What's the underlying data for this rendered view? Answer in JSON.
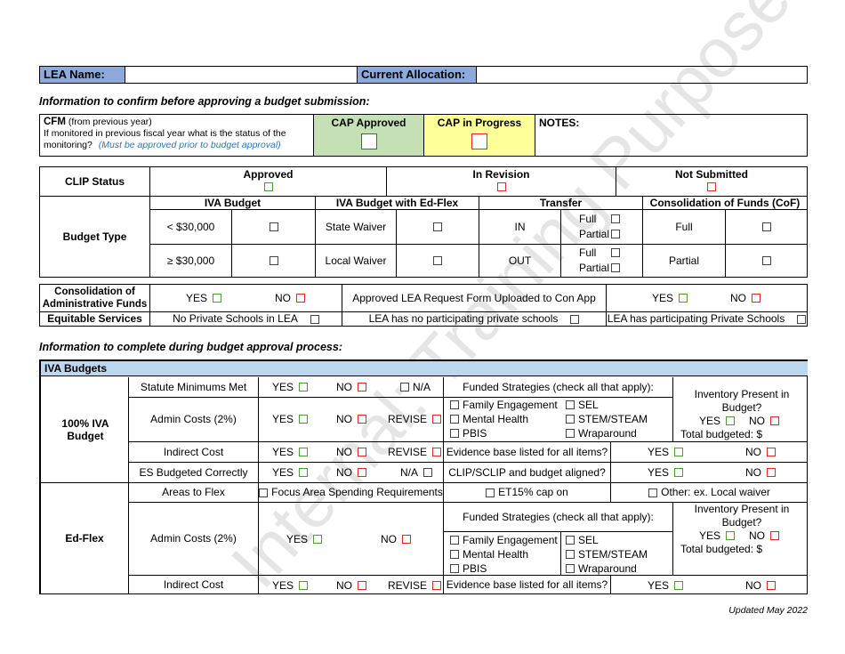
{
  "header": {
    "lea_name_label": "LEA Name:",
    "lea_name_value": "",
    "current_allocation_label": "Current Allocation:",
    "current_allocation_value": ""
  },
  "section1_heading": "Information to confirm before approving a budget submission:",
  "cfm": {
    "title": "CFM",
    "title_suffix": "(from previous year)",
    "question": "If monitored in previous fiscal year what is the status of the monitoring?",
    "note": "(Must be approved prior to budget approval)",
    "cap_approved": "CAP Approved",
    "cap_in_progress": "CAP in Progress",
    "notes_label": "NOTES:"
  },
  "clip": {
    "label": "CLIP Status",
    "options": [
      "Approved",
      "In Revision",
      "Not Submitted"
    ]
  },
  "budget_type": {
    "label": "Budget Type",
    "groups": [
      "IVA Budget",
      "IVA Budget with Ed-Flex",
      "Transfer",
      "Consolidation of Funds (CoF)"
    ],
    "iva_rows": [
      "< $30,000",
      "≥ $30,000"
    ],
    "edflex_rows": [
      "State Waiver",
      "Local Waiver"
    ],
    "transfer_rows": [
      "IN",
      "OUT"
    ],
    "transfer_opts": [
      "Full",
      "Partial"
    ],
    "cof_rows": [
      "Full",
      "Partial"
    ]
  },
  "consolidation": {
    "label": "Consolidation of Administrative Funds",
    "yes": "YES",
    "no": "NO",
    "form_label": "Approved LEA Request Form Uploaded to Con App"
  },
  "equitable": {
    "label": "Equitable Services",
    "options": [
      "No Private Schools in LEA",
      "LEA has no participating private schools",
      "LEA has participating Private Schools"
    ]
  },
  "section2_heading": "Information to complete during budget approval process:",
  "iva_budgets": {
    "title": "IVA Budgets",
    "iva100": {
      "label": "100% IVA Budget",
      "rows": [
        {
          "label": "Statute Minimums Met",
          "opts": [
            "YES",
            "NO",
            "N/A"
          ]
        },
        {
          "label": "Admin Costs (2%)",
          "opts": [
            "YES",
            "NO",
            "REVISE"
          ]
        },
        {
          "label": "Indirect Cost",
          "opts": [
            "YES",
            "NO",
            "REVISE"
          ]
        },
        {
          "label": "ES Budgeted Correctly",
          "opts": [
            "YES",
            "NO",
            "N/A"
          ]
        }
      ],
      "funded_label": "Funded Strategies (check all that apply):",
      "strategies": [
        "Family Engagement",
        "Mental Health",
        "PBIS",
        "SEL",
        "STEM/STEAM",
        "Wraparound"
      ],
      "inventory_label": "Inventory Present in Budget?",
      "total_budgeted": "Total budgeted:  $",
      "evidence_label": "Evidence base listed for all items?",
      "aligned_label": "CLIP/SCLIP and budget aligned?"
    },
    "edflex": {
      "label": "Ed-Flex",
      "areas_label": "Areas to Flex",
      "areas": [
        "Focus Area Spending Requirements",
        "ET15% cap on",
        "Other:  ex. Local waiver"
      ],
      "admin_label": "Admin Costs (2%)",
      "indirect_label": "Indirect Cost"
    }
  },
  "yes": "YES",
  "no": "NO",
  "revise": "REVISE",
  "footer": "Updated May 2022",
  "watermark": "Internal: Training Purposes",
  "colors": {
    "header_blue": "#8eaadb",
    "section_blue": "#bdd7ee",
    "cap_green": "#c5e0b4",
    "cap_yellow": "#ffff99",
    "note_blue": "#2e75b6"
  }
}
